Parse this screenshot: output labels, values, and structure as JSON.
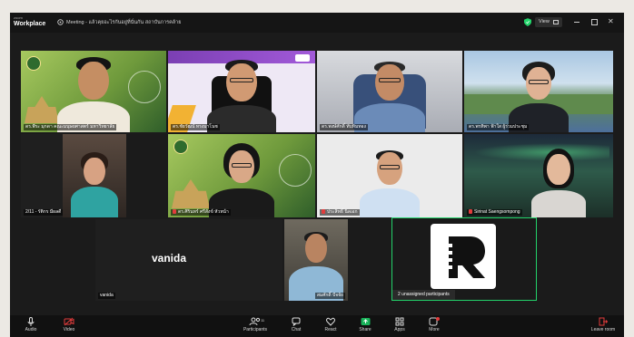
{
  "titlebar": {
    "brand_top": "zoom",
    "brand_bottom": "Workplace",
    "meeting_title": "Meeting - แล้วคุยอะไรกันอยู่ที่นั่นกัน สถาบันการคล้าย",
    "view_label": "View"
  },
  "tiles": [
    {
      "name": "ดร.พีระ มุกดา คณะมนุษยศาสตร์ มหาวิทยาลัย",
      "muted": false,
      "bg": "#7ea44a"
    },
    {
      "name": "ดร.ชัยวัฒน์ ทรงมาโนช",
      "muted": false,
      "bg": "#eee8f5"
    },
    {
      "name": "ดร.พงษ์ศักดิ์ ทับทิมทอง",
      "muted": false,
      "bg": "#b9bcc4"
    },
    {
      "name": "ดร.พรทิพา ฟ้าใส ผู้ร่วมประชุม",
      "muted": false,
      "bg": "#6d8fa8"
    },
    {
      "name": "2/11 - รัติกร มีผลดี",
      "muted": false,
      "bg": "#3a2e2a"
    },
    {
      "name": "ดร.ศิรินทร์ ศรีสังข์ หัวหน้า",
      "muted": true,
      "bg": "#7ea44a"
    },
    {
      "name": "ประสิทธิ์ นิลเอก",
      "muted": true,
      "bg": "#e7e7e7"
    },
    {
      "name": "Sirinat Saengsompong",
      "muted": true,
      "bg": "#2f3f3a"
    },
    {
      "name": "vanida",
      "muted": false,
      "bg": "#1f1f1f"
    },
    {
      "name": "สมศักดิ์ ปัจจัย",
      "muted": false,
      "bg": "#5a574f"
    },
    {
      "name": "2 unassigned participants",
      "muted": false,
      "bg": "#1a1a1a"
    }
  ],
  "vanida_label": "vanida",
  "toolbar": {
    "audio": "Audio",
    "video": "Video",
    "participants": "Participants",
    "participants_count": "11",
    "chat": "Chat",
    "react": "React",
    "share": "Share",
    "apps": "Apps",
    "more": "More",
    "leave": "Leave room"
  },
  "colors": {
    "accent_green": "#23d36a",
    "muted_red": "#e23c3c",
    "share_green": "#19b35a"
  }
}
